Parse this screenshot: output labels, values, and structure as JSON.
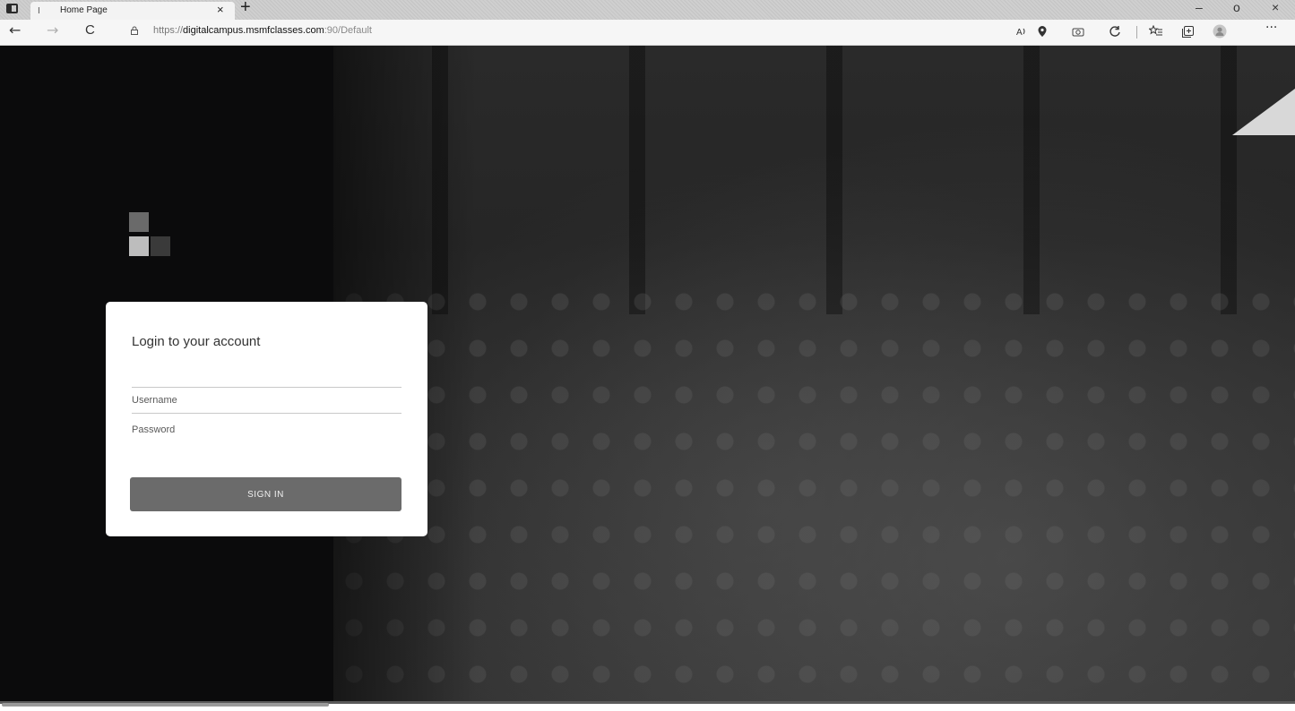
{
  "browser": {
    "tab": {
      "title": "Home Page",
      "favicon": "I",
      "close": "×"
    },
    "new_tab": "+",
    "window_controls": {
      "minimize": "–",
      "maximize": "o",
      "close": "×"
    },
    "nav": {
      "back": "←",
      "forward": "→",
      "refresh": "C"
    },
    "url": {
      "protocol": "https://",
      "host": "digitalcampus.msmfclasses.com",
      "path": ":90/Default"
    },
    "toolbar_icons": [
      "read-aloud-icon",
      "location-icon",
      "camera-icon",
      "sync-icon",
      "favorites-icon",
      "collections-icon",
      "profile-icon",
      "more-icon"
    ],
    "more": "···"
  },
  "login": {
    "title": "Login to your account",
    "username_placeholder": "Username",
    "password_placeholder": "Password",
    "signin_label": "SIGN IN"
  },
  "colors": {
    "sidebar_bg": "#0b0b0c",
    "card_bg": "#ffffff",
    "button_bg": "#6b6b6b",
    "logo_light": "#bdbdbd",
    "logo_mid": "#6a6a6a",
    "logo_dark": "#3a3a3a"
  }
}
